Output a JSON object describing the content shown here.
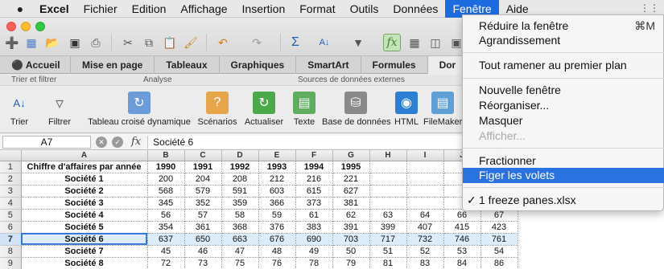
{
  "menubar": {
    "items": [
      "Excel",
      "Fichier",
      "Edition",
      "Affichage",
      "Insertion",
      "Format",
      "Outils",
      "Données",
      "Fenêtre",
      "Aide"
    ],
    "active": "Fenêtre"
  },
  "ribbon": {
    "tabs": [
      "Accueil",
      "Mise en page",
      "Tableaux",
      "Graphiques",
      "SmartArt",
      "Formules",
      "Dor"
    ],
    "groups": [
      "Trier et filtrer",
      "Analyse",
      "Sources de données externes"
    ],
    "buttons": [
      "Trier",
      "Filtrer",
      "Tableau croisé dynamique",
      "Scénarios",
      "Actualiser",
      "Texte",
      "Base de données",
      "HTML",
      "FileMaker"
    ]
  },
  "formula_bar": {
    "name_box": "A7",
    "fx": "fx",
    "value": "Société 6"
  },
  "sheet": {
    "columns": [
      "A",
      "B",
      "C",
      "D",
      "E",
      "F",
      "G",
      "H",
      "I",
      "J",
      "K"
    ],
    "row_numbers": [
      "1",
      "2",
      "3",
      "4",
      "5",
      "6",
      "7",
      "8",
      "9"
    ],
    "header_row": [
      "Chiffre d'affaires par année",
      "1990",
      "1991",
      "1992",
      "1993",
      "1994",
      "1995",
      "",
      "",
      "",
      ""
    ],
    "rows": [
      [
        "Société 1",
        "200",
        "204",
        "208",
        "212",
        "216",
        "221",
        "",
        "",
        "",
        ""
      ],
      [
        "Société 2",
        "568",
        "579",
        "591",
        "603",
        "615",
        "627",
        "",
        "",
        "",
        ""
      ],
      [
        "Société 3",
        "345",
        "352",
        "359",
        "366",
        "373",
        "381",
        "",
        "",
        "",
        ""
      ],
      [
        "Société 4",
        "56",
        "57",
        "58",
        "59",
        "61",
        "62",
        "63",
        "64",
        "66",
        "67"
      ],
      [
        "Société 5",
        "354",
        "361",
        "368",
        "376",
        "383",
        "391",
        "399",
        "407",
        "415",
        "423"
      ],
      [
        "Société 6",
        "637",
        "650",
        "663",
        "676",
        "690",
        "703",
        "717",
        "732",
        "746",
        "761"
      ],
      [
        "Société 7",
        "45",
        "46",
        "47",
        "48",
        "49",
        "50",
        "51",
        "52",
        "53",
        "54"
      ],
      [
        "Société 8",
        "72",
        "73",
        "75",
        "76",
        "78",
        "79",
        "81",
        "83",
        "84",
        "86"
      ]
    ]
  },
  "window_menu": {
    "items": [
      {
        "label": "Réduire la fenêtre",
        "shortcut": "⌘M"
      },
      {
        "label": "Agrandissement"
      },
      {
        "label": "Tout ramener au premier plan"
      },
      {
        "label": "Nouvelle fenêtre"
      },
      {
        "label": "Réorganiser..."
      },
      {
        "label": "Masquer"
      },
      {
        "label": "Afficher..."
      },
      {
        "label": "Fractionner"
      },
      {
        "label": "Figer les volets"
      },
      {
        "label": "1 freeze panes.xlsx",
        "check": "✓"
      }
    ]
  },
  "colors": {
    "menu_highlight": "#2a72df",
    "selection_row": "#dcecf9",
    "active_toolbar_button": "#c3e3b8"
  }
}
